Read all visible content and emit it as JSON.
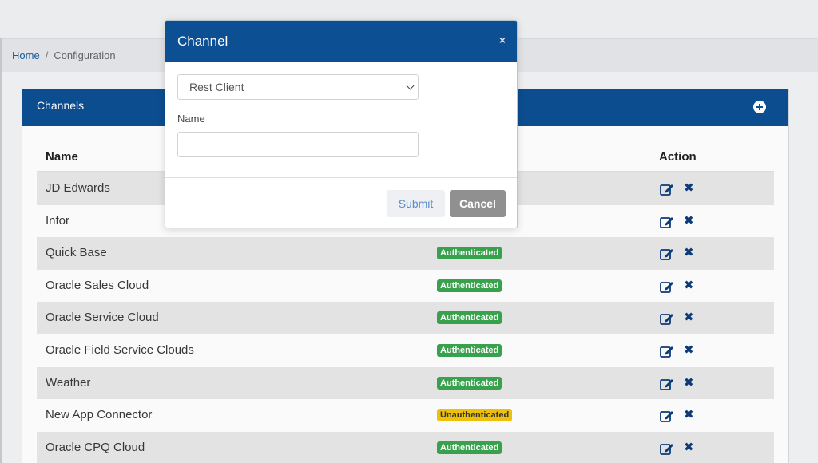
{
  "breadcrumb": {
    "home": "Home",
    "separator": "/",
    "current": "Configuration"
  },
  "card": {
    "title": "Channels"
  },
  "table": {
    "headers": {
      "name": "Name",
      "action": "Action"
    },
    "rows": [
      {
        "name": "JD Edwards",
        "status": ""
      },
      {
        "name": "Infor",
        "status": ""
      },
      {
        "name": "Quick Base",
        "status": "Authenticated"
      },
      {
        "name": "Oracle Sales Cloud",
        "status": "Authenticated"
      },
      {
        "name": "Oracle Service Cloud",
        "status": "Authenticated"
      },
      {
        "name": "Oracle Field Service Clouds",
        "status": "Authenticated"
      },
      {
        "name": "Weather",
        "status": "Authenticated"
      },
      {
        "name": "New App Connector",
        "status": "Unauthenticated"
      },
      {
        "name": "Oracle CPQ Cloud",
        "status": "Authenticated"
      }
    ]
  },
  "modal": {
    "title": "Channel",
    "close": "×",
    "select_value": "Rest Client",
    "name_label": "Name",
    "name_value": "",
    "submit_label": "Submit",
    "cancel_label": "Cancel"
  },
  "icons": {
    "add": "plus-circle-icon",
    "edit": "edit-icon",
    "delete": "close-icon",
    "dropdown": "chevron-down-icon"
  },
  "colors": {
    "primary": "#0d4f93",
    "authenticated": "#3aa54f",
    "unauthenticated": "#f2c40d"
  }
}
